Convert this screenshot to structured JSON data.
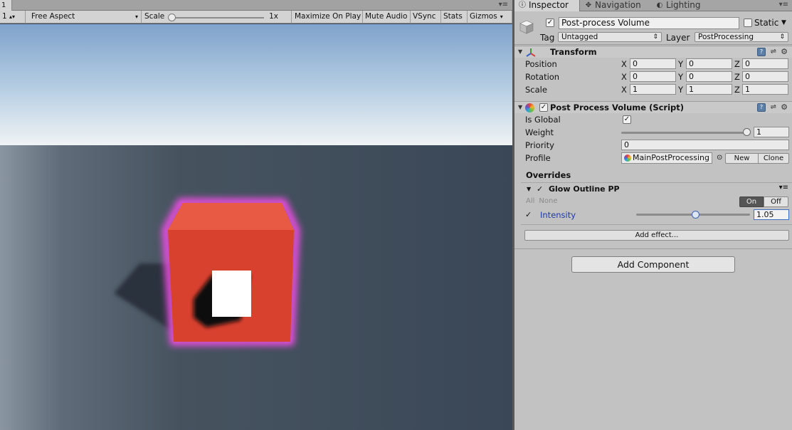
{
  "game_view": {
    "tab_label": "1",
    "toolbar": {
      "display_value": "1",
      "aspect_label": "Free Aspect",
      "scale_label": "Scale",
      "scale_value": "1x",
      "scale_slider_fraction": 0.0,
      "maximize_on_play": "Maximize On Play",
      "mute_audio": "Mute Audio",
      "vsync": "VSync",
      "stats": "Stats",
      "gizmos": "Gizmos"
    },
    "colors": {
      "sky_top": "#7fa3cc",
      "sky_horizon": "#f0f3f5",
      "ground": "#3d4a5a",
      "cube": "#e04836",
      "glow": "#ff4df0",
      "inner_cube": "#ffffff"
    }
  },
  "inspector": {
    "tabs": [
      {
        "label": "Inspector",
        "icon": "info-icon"
      },
      {
        "label": "Navigation",
        "icon": "navigation-icon"
      },
      {
        "label": "Lighting",
        "icon": "lighting-icon"
      }
    ],
    "object": {
      "active": true,
      "name": "Post-process Volume",
      "static_label": "Static",
      "static": false,
      "tag_label": "Tag",
      "tag_value": "Untagged",
      "layer_label": "Layer",
      "layer_value": "PostProcessing"
    },
    "transform": {
      "title": "Transform",
      "position_label": "Position",
      "rotation_label": "Rotation",
      "scale_label": "Scale",
      "axis_x": "X",
      "axis_y": "Y",
      "axis_z": "Z",
      "position": {
        "x": "0",
        "y": "0",
        "z": "0"
      },
      "rotation": {
        "x": "0",
        "y": "0",
        "z": "0"
      },
      "scale": {
        "x": "1",
        "y": "1",
        "z": "1"
      }
    },
    "post_process": {
      "title": "Post Process Volume (Script)",
      "enabled": true,
      "is_global_label": "Is Global",
      "is_global": true,
      "weight_label": "Weight",
      "weight_value": "1",
      "weight_fraction": 1.0,
      "priority_label": "Priority",
      "priority_value": "0",
      "profile_label": "Profile",
      "profile_value": "MainPostProcessing",
      "picker_glyph": "⊙",
      "new_label": "New",
      "clone_label": "Clone",
      "overrides_label": "Overrides",
      "effect": {
        "title": "Glow Outline PP",
        "enabled": true,
        "check_glyph": "✓",
        "all_label": "All",
        "none_label": "None",
        "on_label": "On",
        "off_label": "Off",
        "intensity_label": "Intensity",
        "intensity_value": "1.05",
        "intensity_fraction": 0.52
      },
      "add_effect_label": "Add effect..."
    },
    "add_component_label": "Add Component"
  }
}
